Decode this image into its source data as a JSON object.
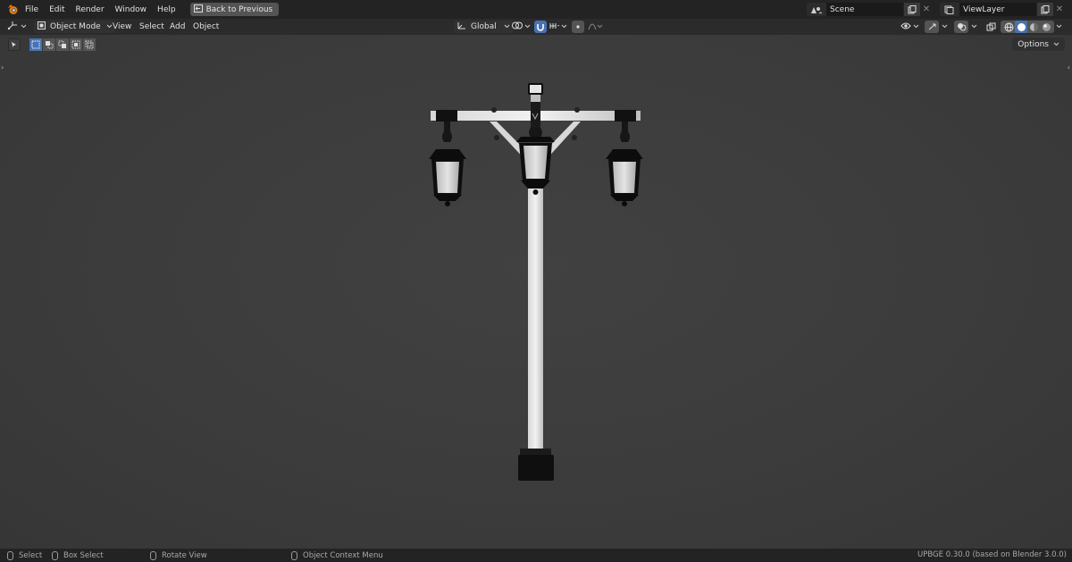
{
  "menu": {
    "items": [
      "File",
      "Edit",
      "Render",
      "Window",
      "Help"
    ],
    "back_label": "Back to Previous"
  },
  "scene": {
    "name": "Scene"
  },
  "view_layer": {
    "name": "ViewLayer"
  },
  "header": {
    "mode_label": "Object Mode",
    "view_label": "View",
    "select_label": "Select",
    "add_label": "Add",
    "object_label": "Object",
    "transform_label": "Global"
  },
  "viewport": {
    "options_label": "Options"
  },
  "status": {
    "select_label": "Select",
    "box_select_label": "Box Select",
    "rotate_label": "Rotate View",
    "context_label": "Object Context Menu",
    "version": "UPBGE 0.30.0 (based on Blender 3.0.0)"
  },
  "colors": {
    "accent": "#4772b3",
    "logo": "#e87d0d",
    "viewport_bg": "#3d3d3d"
  }
}
